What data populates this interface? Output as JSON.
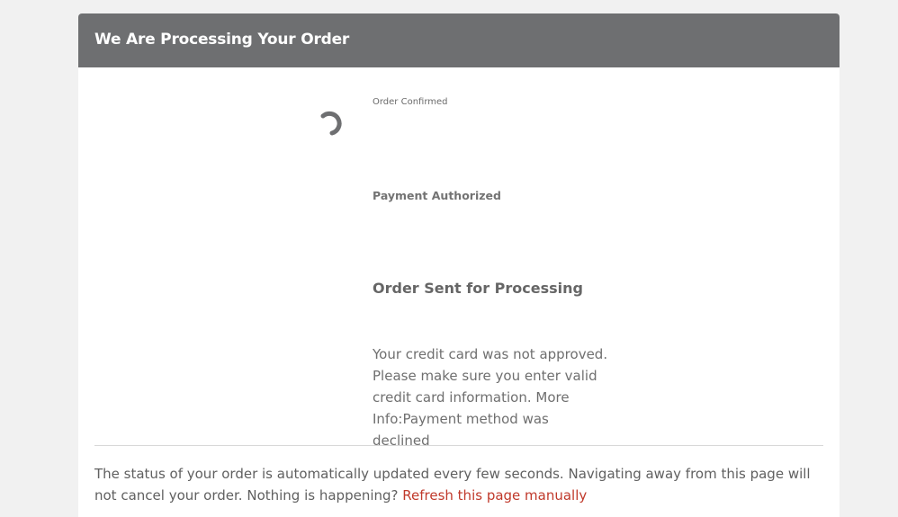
{
  "header": {
    "title": "We Are Processing Your Order"
  },
  "steps": [
    {
      "label": "Order Confirmed"
    },
    {
      "label": "Payment Authorized"
    },
    {
      "label": "Order Sent for Processing"
    }
  ],
  "spinner": {
    "icon": "loading-spinner-icon",
    "color": "#6e6f71"
  },
  "error": {
    "message": "Your credit card was not approved. Please make sure you enter valid credit card information. More Info:Payment method was declined"
  },
  "footer": {
    "status_text": "The status of your order is automatically updated every few seconds. Navigating away from this page will not cancel your order. Nothing is happening?",
    "refresh_link": "Refresh this page manually",
    "link_color": "#c0392b"
  }
}
